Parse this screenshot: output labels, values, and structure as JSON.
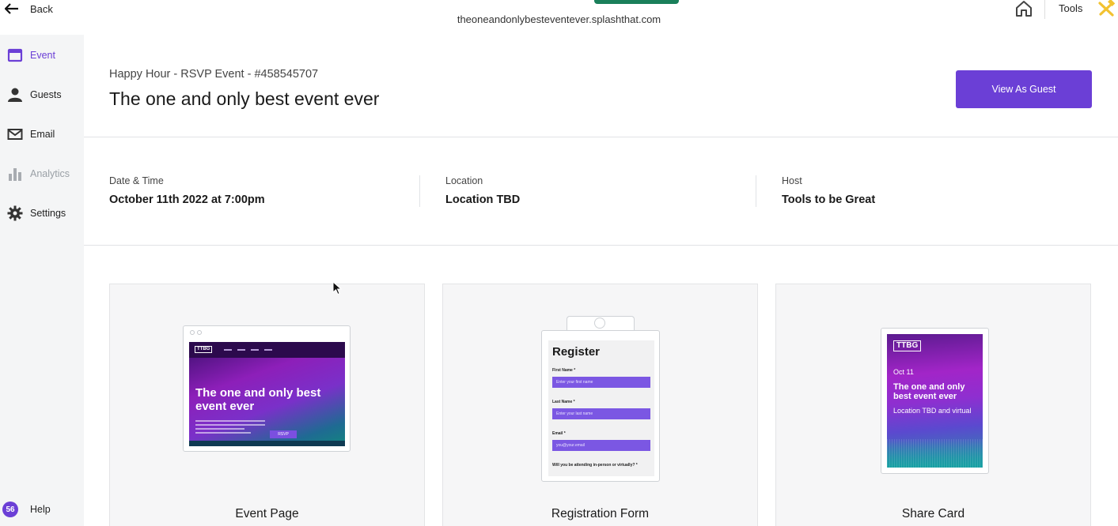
{
  "topbar": {
    "back_label": "Back",
    "url": "theoneandonlybesteventever.splashthat.com",
    "tools_label": "Tools",
    "accent_green": "#1a7f5a"
  },
  "sidebar": {
    "items": [
      {
        "label": "Event",
        "icon": "calendar-icon",
        "active": true
      },
      {
        "label": "Guests",
        "icon": "person-icon"
      },
      {
        "label": "Email",
        "icon": "envelope-icon"
      },
      {
        "label": "Analytics",
        "icon": "bar-chart-icon",
        "disabled": true
      },
      {
        "label": "Settings",
        "icon": "gear-icon"
      }
    ],
    "help": {
      "badge": "56",
      "label": "Help"
    },
    "accent": "#6b3fd6"
  },
  "header": {
    "subtitle": "Happy Hour - RSVP Event - #458545707",
    "title": "The one and only best event ever",
    "view_guest_button": "View As Guest"
  },
  "details": {
    "date_label": "Date & Time",
    "date_value": "October 11th 2022 at 7:00pm",
    "location_label": "Location",
    "location_value": "Location TBD",
    "host_label": "Host",
    "host_value": "Tools to be Great"
  },
  "cards": {
    "event_page": {
      "caption": "Event Page",
      "logo": "TTBG",
      "headline": "The one and only best event ever",
      "rsvp": "RSVP"
    },
    "registration_form": {
      "caption": "Registration Form",
      "heading": "Register",
      "fields": [
        {
          "label": "First Name *",
          "placeholder": "Enter your first name"
        },
        {
          "label": "Last Name *",
          "placeholder": "Enter your last name"
        },
        {
          "label": "Email *",
          "placeholder": "you@your.email"
        }
      ],
      "question": "Will you be attending in-person or virtually? *"
    },
    "share_card": {
      "caption": "Share Card",
      "logo": "TTBG",
      "date": "Oct 11",
      "title": "The one and only best event ever",
      "location": "Location TBD and virtual"
    }
  }
}
